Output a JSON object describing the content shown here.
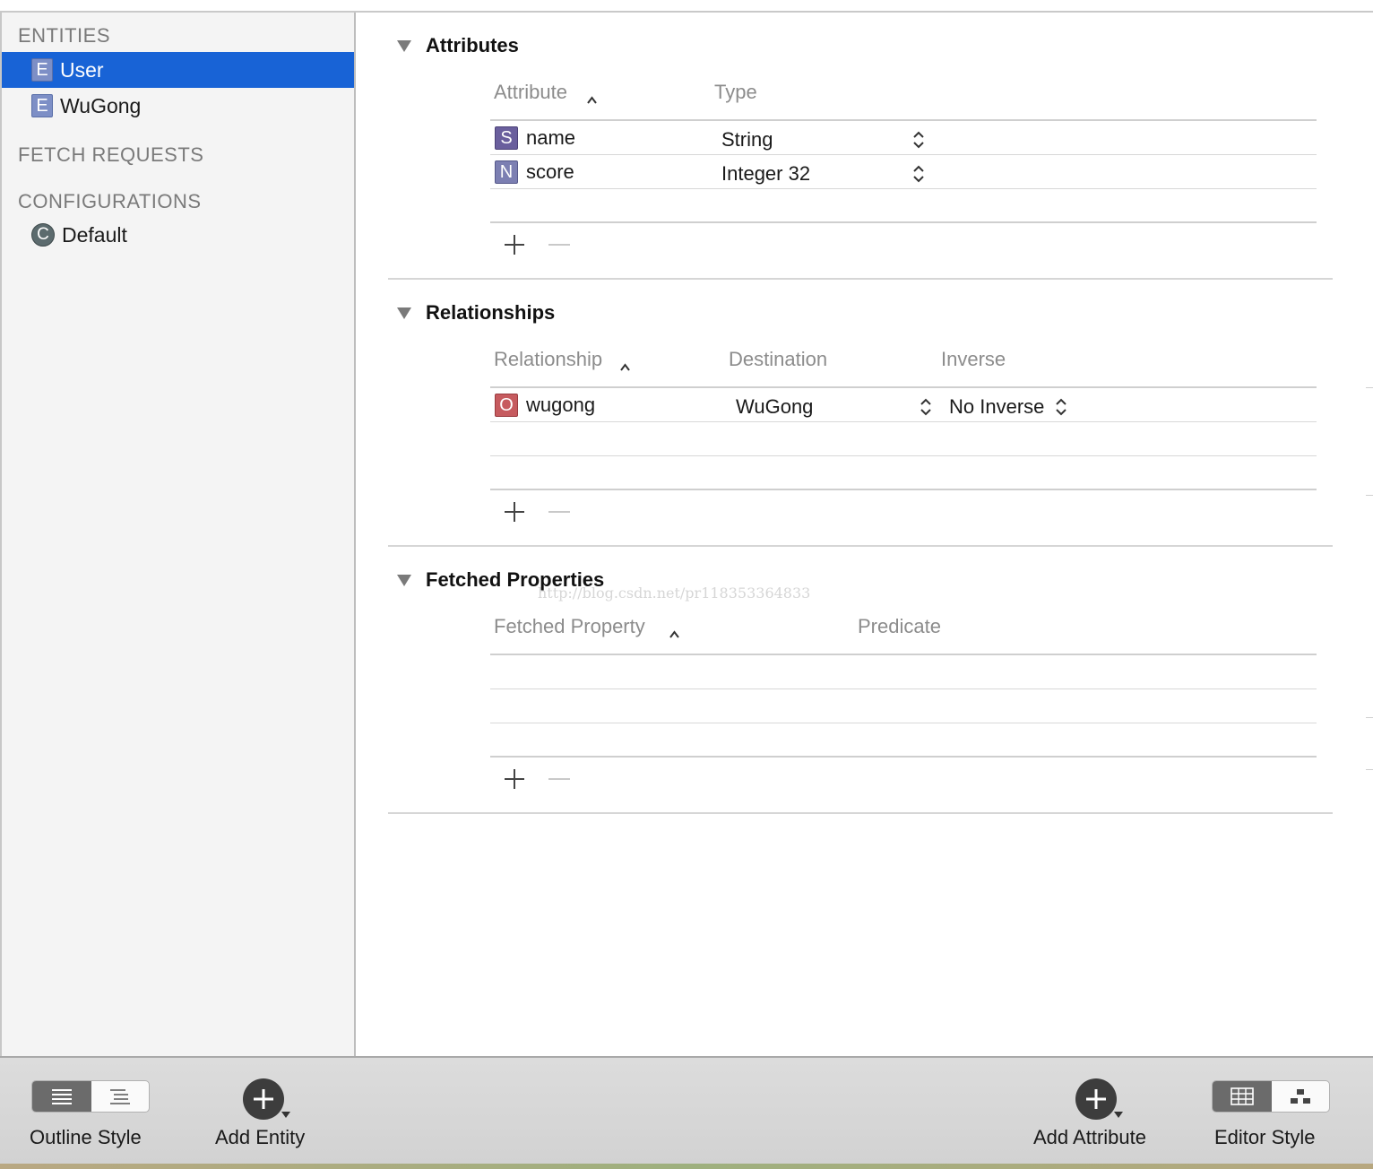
{
  "sidebar": {
    "entities_header": "ENTITIES",
    "entities": [
      {
        "label": "User",
        "badge": "E",
        "selected": true
      },
      {
        "label": "WuGong",
        "badge": "E",
        "selected": false
      }
    ],
    "fetch_requests_header": "FETCH REQUESTS",
    "configurations_header": "CONFIGURATIONS",
    "configurations": [
      {
        "label": "Default",
        "badge": "C"
      }
    ]
  },
  "attributes": {
    "title": "Attributes",
    "columns": [
      "Attribute",
      "Type"
    ],
    "rows": [
      {
        "badge": "S",
        "name": "name",
        "type": "String"
      },
      {
        "badge": "N",
        "name": "score",
        "type": "Integer 32"
      }
    ]
  },
  "relationships": {
    "title": "Relationships",
    "columns": [
      "Relationship",
      "Destination",
      "Inverse"
    ],
    "rows": [
      {
        "badge": "O",
        "name": "wugong",
        "destination": "WuGong",
        "inverse": "No Inverse"
      }
    ]
  },
  "fetched_properties": {
    "title": "Fetched Properties",
    "columns": [
      "Fetched Property",
      "Predicate"
    ],
    "rows": []
  },
  "watermark": "http://blog.csdn.net/pr118353364833",
  "toolbar": {
    "outline_style_label": "Outline Style",
    "add_entity_label": "Add Entity",
    "add_attribute_label": "Add Attribute",
    "editor_style_label": "Editor Style"
  },
  "colors": {
    "selection": "#1863d6",
    "badge_entity": "#7d8fc6",
    "badge_string": "#6a5f9d",
    "badge_number": "#7c7fb2",
    "badge_relationship": "#c65b5f"
  }
}
